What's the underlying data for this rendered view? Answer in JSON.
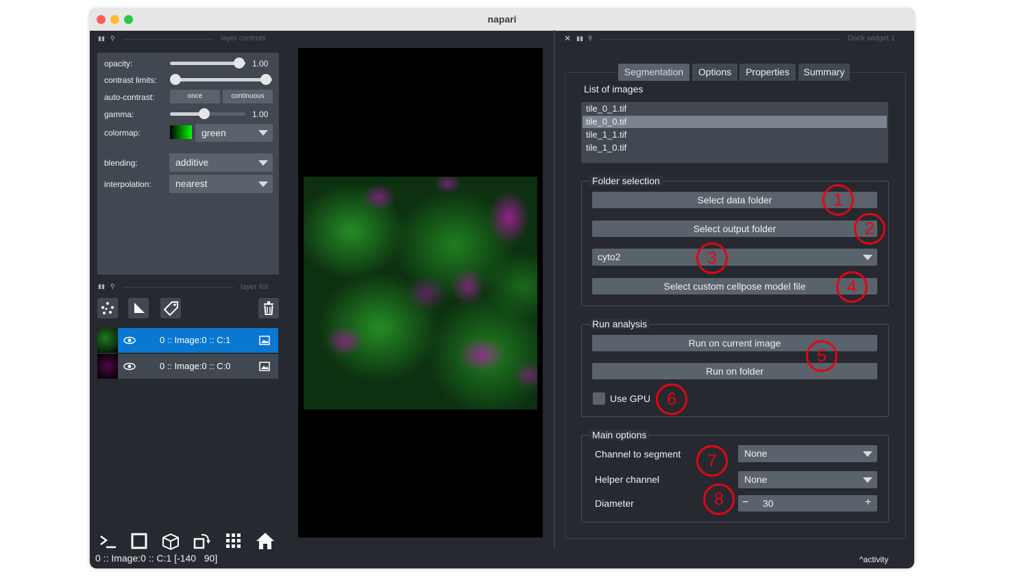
{
  "window": {
    "title": "napari"
  },
  "left_dock": {
    "layer_controls_title": "layer controls",
    "layer_list_title": "layer list",
    "controls": {
      "opacity_label": "opacity:",
      "opacity_value": "1.00",
      "contrast_label": "contrast limits:",
      "autocontrast_label": "auto-contrast:",
      "once_label": "once",
      "continuous_label": "continuous",
      "gamma_label": "gamma:",
      "gamma_value": "1.00",
      "colormap_label": "colormap:",
      "colormap_value": "green",
      "blending_label": "blending:",
      "blending_value": "additive",
      "interpolation_label": "interpolation:",
      "interpolation_value": "nearest"
    },
    "layers": [
      {
        "name": "0 :: Image:0 :: C:1",
        "selected": true
      },
      {
        "name": "0 :: Image:0 :: C:0",
        "selected": false
      }
    ]
  },
  "status_bar": {
    "text": "0 :: Image:0 :: C:1 [-140   90]",
    "activity": "activity"
  },
  "right_dock": {
    "title": "Dock widget 1",
    "tabs": [
      "Segmentation",
      "Options",
      "Properties",
      "Summary"
    ],
    "list_title": "List of images",
    "images": [
      "tile_0_1.tif",
      "tile_0_0.tif",
      "tile_1_1.tif",
      "tile_1_0.tif"
    ],
    "selected_image": "tile_0_0.tif",
    "folder_selection": {
      "title": "Folder selection",
      "data_folder_button": "Select data folder",
      "output_folder_button": "Select output folder",
      "model_value": "cyto2",
      "custom_model_button": "Select custom cellpose model file"
    },
    "run_analysis": {
      "title": "Run analysis",
      "run_current_button": "Run on current image",
      "run_folder_button": "Run on folder",
      "use_gpu_label": "Use GPU"
    },
    "main_options": {
      "title": "Main options",
      "channel_label": "Channel to segment",
      "channel_value": "None",
      "helper_label": "Helper channel",
      "helper_value": "None",
      "diameter_label": "Diameter",
      "diameter_value": "30"
    }
  },
  "annotations": [
    "1",
    "2",
    "3",
    "4",
    "5",
    "6",
    "7",
    "8"
  ],
  "colors": {
    "window_bg": "#262930",
    "panel": "#414851",
    "button": "#5a626c",
    "selection": "#0a77d0",
    "annotation": "#e30613"
  }
}
